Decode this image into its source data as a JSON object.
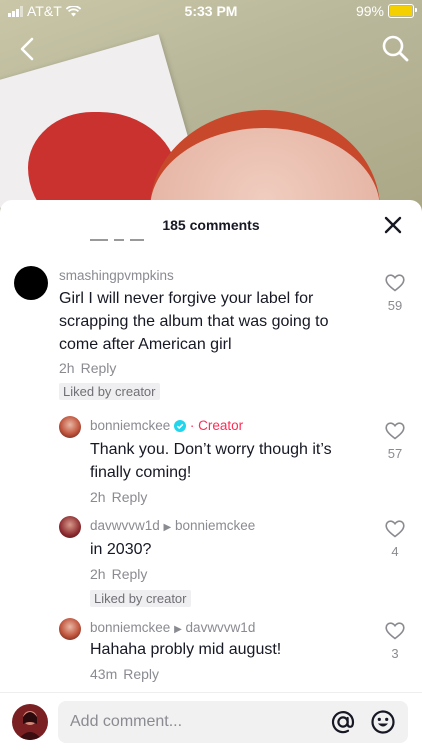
{
  "status_bar": {
    "carrier": "AT&T",
    "time": "5:33 PM",
    "battery": "99%",
    "battery_level": 0.99
  },
  "sheet": {
    "title": "185 comments"
  },
  "comments": [
    {
      "username": "smashingpvmpkins",
      "text": "Girl I will never forgive your label for scrapping the album that was going to come after American girl",
      "time": "2h",
      "reply_label": "Reply",
      "badge": "Liked by creator",
      "likes": "59"
    },
    {
      "username": "bonniemckee",
      "creator_label": "Creator",
      "text": "Thank you. Don’t worry though it’s finally coming!",
      "time": "2h",
      "reply_label": "Reply",
      "likes": "57"
    },
    {
      "username": "davwvvw1d",
      "reply_to": "bonniemckee",
      "text": "in 2030?",
      "time": "2h",
      "reply_label": "Reply",
      "badge": "Liked by creator",
      "likes": "4"
    },
    {
      "username": "bonniemckee",
      "reply_to": "davwvvw1d",
      "text": "Hahaha probly mid august!",
      "time": "43m",
      "reply_label": "Reply",
      "likes": "3"
    }
  ],
  "composer": {
    "placeholder": "Add comment..."
  },
  "colors": {
    "accent": "#fe2c55",
    "verified": "#20d5ec",
    "battery": "#f5d000"
  }
}
